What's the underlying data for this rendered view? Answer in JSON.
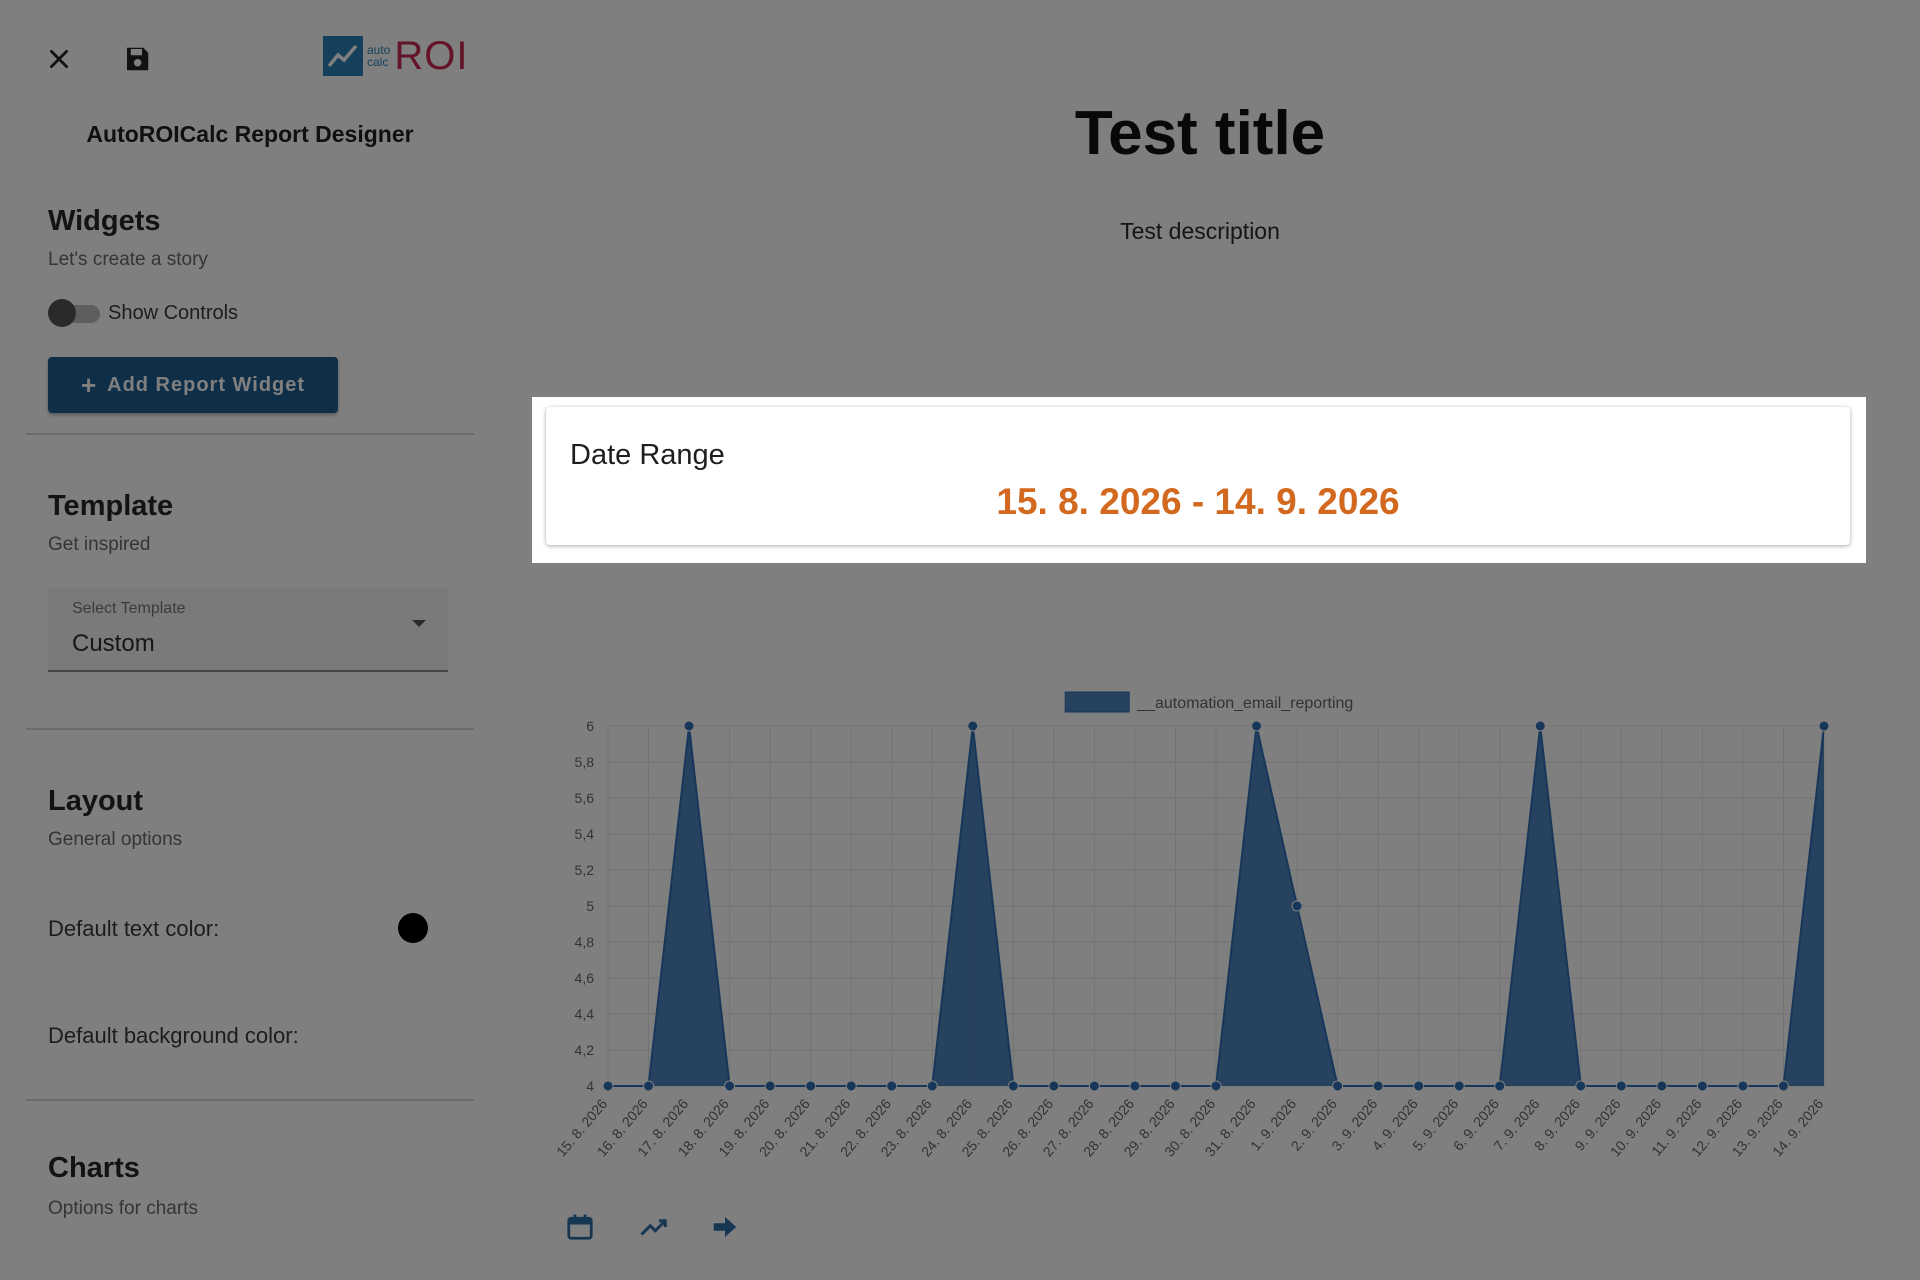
{
  "sidebar": {
    "app_title": "AutoROICalc Report Designer",
    "logo": {
      "small_top": "auto",
      "small_bottom": "calc",
      "big": "ROI"
    },
    "widgets": {
      "title": "Widgets",
      "subtitle": "Let's create a story",
      "show_controls_label": "Show Controls",
      "show_controls_on": false,
      "add_button_label": "Add Report Widget"
    },
    "template": {
      "title": "Template",
      "subtitle": "Get inspired",
      "select_label": "Select Template",
      "select_value": "Custom"
    },
    "layout": {
      "title": "Layout",
      "subtitle": "General options",
      "text_color_label": "Default text color:",
      "text_color": "#000000",
      "bg_color_label": "Default background color:"
    },
    "charts": {
      "title": "Charts",
      "subtitle": "Options for charts"
    }
  },
  "main": {
    "title": "Test title",
    "description": "Test description",
    "date_widget": {
      "label": "Date Range",
      "value": "15. 8. 2026 - 14. 9. 2026",
      "value_color": "#d2691e"
    }
  },
  "chart_data": {
    "type": "area",
    "categories": [
      "15. 8. 2026",
      "16. 8. 2026",
      "17. 8. 2026",
      "18. 8. 2026",
      "19. 8. 2026",
      "20. 8. 2026",
      "21. 8. 2026",
      "22. 8. 2026",
      "23. 8. 2026",
      "24. 8. 2026",
      "25. 8. 2026",
      "26. 8. 2026",
      "27. 8. 2026",
      "28. 8. 2026",
      "29. 8. 2026",
      "30. 8. 2026",
      "31. 8. 2026",
      "1. 9. 2026",
      "2. 9. 2026",
      "3. 9. 2026",
      "4. 9. 2026",
      "5. 9. 2026",
      "6. 9. 2026",
      "7. 9. 2026",
      "8. 9. 2026",
      "9. 9. 2026",
      "10. 9. 2026",
      "11. 9. 2026",
      "12. 9. 2026",
      "13. 9. 2026",
      "14. 9. 2026"
    ],
    "series": [
      {
        "name": "__automation_email_reporting",
        "values": [
          4,
          4,
          6,
          4,
          4,
          4,
          4,
          4,
          4,
          6,
          4,
          4,
          4,
          4,
          4,
          4,
          6,
          5,
          4,
          4,
          4,
          4,
          4,
          6,
          4,
          4,
          4,
          4,
          4,
          4,
          6
        ]
      }
    ],
    "y_ticks": [
      "4",
      "4,2",
      "4,4",
      "4,6",
      "4,8",
      "5",
      "5,2",
      "5,4",
      "5,6",
      "5,8",
      "6"
    ],
    "ylim": [
      4,
      6
    ],
    "grid": true,
    "legend_position": "top",
    "series_color": "#2e6fb4"
  },
  "chart_toolbar": {
    "icons": [
      "calendar-icon",
      "trending-up-icon",
      "arrow-right-icon"
    ]
  }
}
